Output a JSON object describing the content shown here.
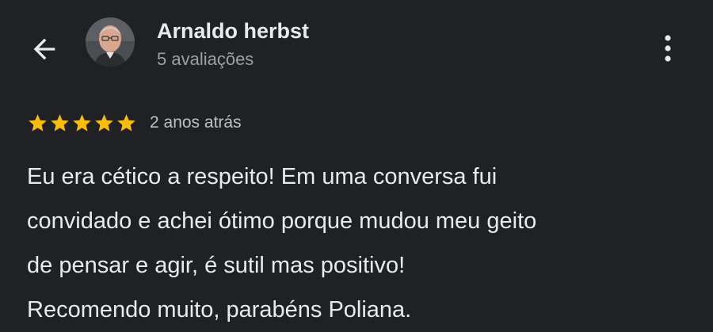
{
  "reviewer": {
    "name": "Arnaldo herbst",
    "reviews_count_label": "5 avaliações"
  },
  "icons": {
    "back": "arrow-back-icon",
    "more": "more-vert-icon",
    "star": "star-icon"
  },
  "review": {
    "rating": 5,
    "max_rating": 5,
    "time_label": "2 anos atrás",
    "lines": [
      "Eu era cético a respeito! Em uma conversa fui",
      "convidado e achei ótimo porque mudou meu geito",
      "de pensar e agir, é sutil mas positivo!",
      "Recomendo muito, parabéns Poliana."
    ]
  },
  "colors": {
    "background": "#202124",
    "text": "#e8eaed",
    "secondary_text": "#9aa0a6",
    "star": "#fbbc04"
  }
}
